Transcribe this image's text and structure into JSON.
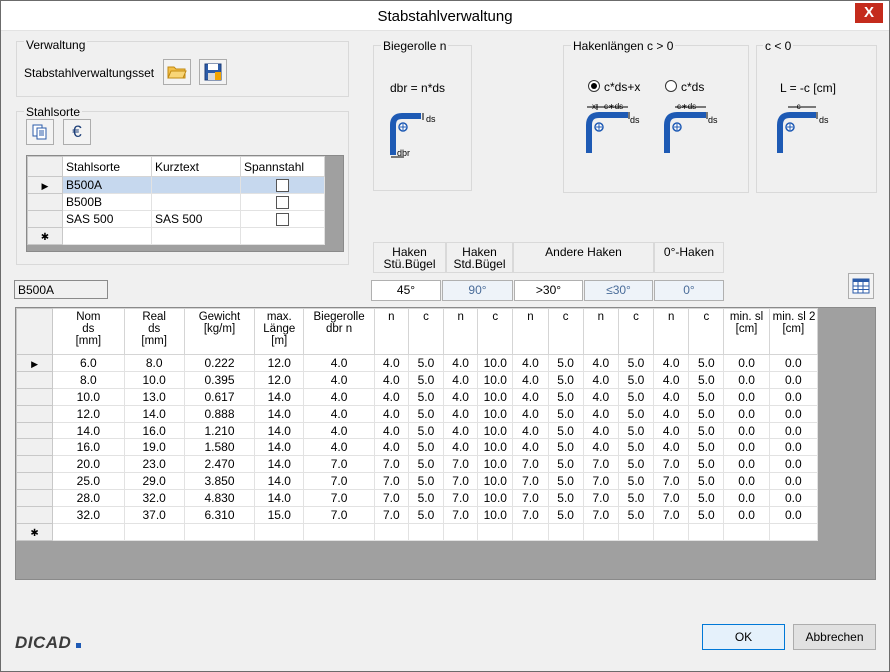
{
  "window": {
    "title": "Stabstahlverwaltung",
    "close_label": "X"
  },
  "verwaltung": {
    "group_label": "Verwaltung",
    "set_label": "Stabstahlverwaltungsset"
  },
  "stahlsorte": {
    "group_label": "Stahlsorte",
    "euro_label": "€",
    "columns": [
      "Stahlsorte",
      "Kurztext",
      "Spannstahl"
    ],
    "rows": [
      {
        "stahlsorte": "B500A",
        "kurztext": "",
        "spannstahl": false
      },
      {
        "stahlsorte": "B500B",
        "kurztext": "",
        "spannstahl": false
      },
      {
        "stahlsorte": "SAS 500",
        "kurztext": "SAS 500",
        "spannstahl": false
      }
    ],
    "selected_marker": "▶",
    "new_marker": "✱"
  },
  "biegerolle": {
    "label": "Biegerolle n",
    "formula": "dbr = n*ds",
    "ds": "ds",
    "dbr": "dbr"
  },
  "haken_pos": {
    "label": "Hakenlängen c > 0",
    "option1": "c*ds+x",
    "option2": "c*ds",
    "fig1_x": "x",
    "fig1_c": "c∗ds",
    "fig2_c": "c∗ds",
    "ds": "ds"
  },
  "haken_neg": {
    "label": "c < 0",
    "formula": "L = -c  [cm]",
    "fig_c": "-c",
    "ds": "ds"
  },
  "haken_headers": {
    "h1_line1": "Haken",
    "h1_line2": "Stü.Bügel",
    "h2_line1": "Haken",
    "h2_line2": "Std.Bügel",
    "h3": "Andere Haken",
    "h4": "0°-Haken"
  },
  "angles": [
    "45°",
    "90°",
    ">30°",
    "≤30°",
    "0°"
  ],
  "current_sort": "B500A",
  "table": {
    "headers": [
      [
        "Nom",
        "ds",
        "[mm]"
      ],
      [
        "Real",
        "ds",
        "[mm]"
      ],
      [
        "Gewicht",
        "[kg/m]"
      ],
      [
        "max.",
        "Länge",
        "[m]"
      ],
      [
        "Biegerolle",
        "dbr n"
      ],
      [
        "n"
      ],
      [
        "c"
      ],
      [
        "n"
      ],
      [
        "c"
      ],
      [
        "n"
      ],
      [
        "c"
      ],
      [
        "n"
      ],
      [
        "c"
      ],
      [
        "n"
      ],
      [
        "c"
      ],
      [
        "min. sl",
        "[cm]"
      ],
      [
        "min. sl 2",
        "[cm]"
      ]
    ],
    "rows": [
      [
        "6.0",
        "8.0",
        "0.222",
        "12.0",
        "4.0",
        "4.0",
        "5.0",
        "4.0",
        "10.0",
        "4.0",
        "5.0",
        "4.0",
        "5.0",
        "4.0",
        "5.0",
        "0.0",
        "0.0"
      ],
      [
        "8.0",
        "10.0",
        "0.395",
        "12.0",
        "4.0",
        "4.0",
        "5.0",
        "4.0",
        "10.0",
        "4.0",
        "5.0",
        "4.0",
        "5.0",
        "4.0",
        "5.0",
        "0.0",
        "0.0"
      ],
      [
        "10.0",
        "13.0",
        "0.617",
        "14.0",
        "4.0",
        "4.0",
        "5.0",
        "4.0",
        "10.0",
        "4.0",
        "5.0",
        "4.0",
        "5.0",
        "4.0",
        "5.0",
        "0.0",
        "0.0"
      ],
      [
        "12.0",
        "14.0",
        "0.888",
        "14.0",
        "4.0",
        "4.0",
        "5.0",
        "4.0",
        "10.0",
        "4.0",
        "5.0",
        "4.0",
        "5.0",
        "4.0",
        "5.0",
        "0.0",
        "0.0"
      ],
      [
        "14.0",
        "16.0",
        "1.210",
        "14.0",
        "4.0",
        "4.0",
        "5.0",
        "4.0",
        "10.0",
        "4.0",
        "5.0",
        "4.0",
        "5.0",
        "4.0",
        "5.0",
        "0.0",
        "0.0"
      ],
      [
        "16.0",
        "19.0",
        "1.580",
        "14.0",
        "4.0",
        "4.0",
        "5.0",
        "4.0",
        "10.0",
        "4.0",
        "5.0",
        "4.0",
        "5.0",
        "4.0",
        "5.0",
        "0.0",
        "0.0"
      ],
      [
        "20.0",
        "23.0",
        "2.470",
        "14.0",
        "7.0",
        "7.0",
        "5.0",
        "7.0",
        "10.0",
        "7.0",
        "5.0",
        "7.0",
        "5.0",
        "7.0",
        "5.0",
        "0.0",
        "0.0"
      ],
      [
        "25.0",
        "29.0",
        "3.850",
        "14.0",
        "7.0",
        "7.0",
        "5.0",
        "7.0",
        "10.0",
        "7.0",
        "5.0",
        "7.0",
        "5.0",
        "7.0",
        "5.0",
        "0.0",
        "0.0"
      ],
      [
        "28.0",
        "32.0",
        "4.830",
        "14.0",
        "7.0",
        "7.0",
        "5.0",
        "7.0",
        "10.0",
        "7.0",
        "5.0",
        "7.0",
        "5.0",
        "7.0",
        "5.0",
        "0.0",
        "0.0"
      ],
      [
        "32.0",
        "37.0",
        "6.310",
        "15.0",
        "7.0",
        "7.0",
        "5.0",
        "7.0",
        "10.0",
        "7.0",
        "5.0",
        "7.0",
        "5.0",
        "7.0",
        "5.0",
        "0.0",
        "0.0"
      ]
    ]
  },
  "footer": {
    "logo": "DICAD",
    "ok_label": "OK",
    "cancel_label": "Abbrechen"
  },
  "colors": {
    "bar_blue": "#1e5ab4",
    "close_red": "#c42b1c",
    "selection": "#c6d8ee"
  }
}
